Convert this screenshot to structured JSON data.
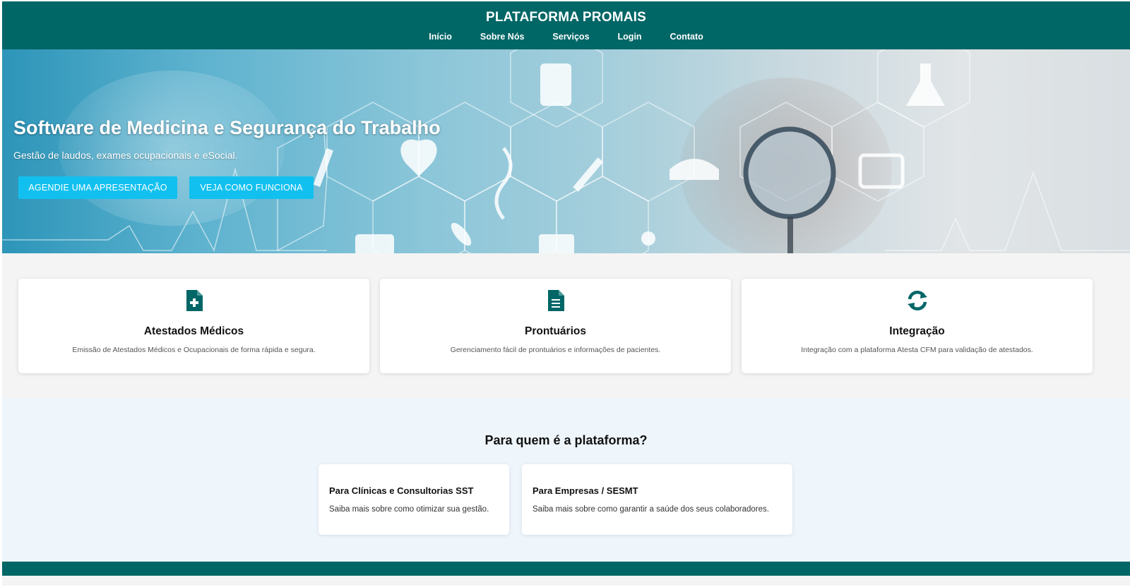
{
  "header": {
    "brand": "PLATAFORMA PROMAIS",
    "nav": [
      {
        "label": "Início"
      },
      {
        "label": "Sobre Nós"
      },
      {
        "label": "Serviços"
      },
      {
        "label": "Login"
      },
      {
        "label": "Contato"
      }
    ]
  },
  "hero": {
    "title": "Software de Medicina e Segurança do Trabalho",
    "subtitle": "Gestão de laudos, exames ocupacionais e eSocial.",
    "primary_button": "AGENDIE UMA APRESENTAÇÃO",
    "secondary_button": "VEJA COMO FUNCIONA"
  },
  "features": [
    {
      "icon": "file-medical-icon",
      "title": "Atestados Médicos",
      "description": "Emissão de Atestados Médicos e Ocupacionais de forma rápida e segura."
    },
    {
      "icon": "file-text-icon",
      "title": "Prontuários",
      "description": "Gerenciamento fácil de prontuários e informações de pacientes."
    },
    {
      "icon": "sync-icon",
      "title": "Integração",
      "description": "Integração com a plataforma Atesta CFM para validação de atestados."
    }
  ],
  "audience": {
    "title": "Para quem é a plataforma?",
    "cards": [
      {
        "title": "Para Clínicas e Consultorias SST",
        "description": "Saiba mais sobre como otimizar sua gestão."
      },
      {
        "title": "Para Empresas / SESMT",
        "description": "Saiba mais sobre como garantir a saúde dos seus colaboradores."
      }
    ]
  },
  "colors": {
    "primary": "#006666",
    "button": "#12c0ef",
    "section_bg": "#eef6fc"
  }
}
